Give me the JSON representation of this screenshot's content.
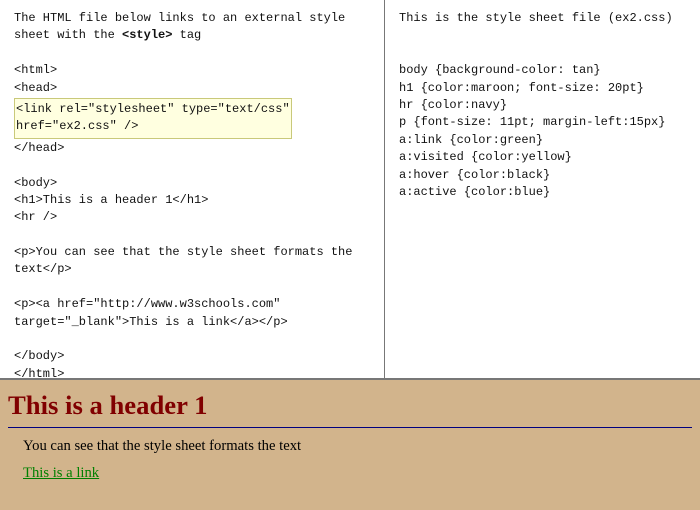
{
  "left": {
    "intro_pre": "The HTML file below links to an external style sheet with the ",
    "intro_bold": "<style>",
    "intro_post": " tag",
    "code1": "<html>",
    "code2": "<head>",
    "hl1": "<link rel=\"stylesheet\" type=\"text/css\"",
    "hl2": " href=\"ex2.css\" />",
    "code3": "</head>",
    "code4": "<body>",
    "code5": "<h1>This is a header 1</h1>",
    "code6": "<hr />",
    "code7": "<p>You can see that the style sheet formats the text</p>",
    "code8": "<p><a href=\"http://www.w3schools.com\" target=\"_blank\">This is a link</a></p>",
    "code9": "</body>",
    "code10": "</html>"
  },
  "right": {
    "intro": "This is the style sheet file (ex2.css)",
    "l1": "body {background-color: tan}",
    "l2": "h1 {color:maroon; font-size: 20pt}",
    "l3": "hr {color:navy}",
    "l4": "p {font-size: 11pt; margin-left:15px}",
    "l5": "a:link    {color:green}",
    "l6": "a:visited {color:yellow}",
    "l7": "a:hover   {color:black}",
    "l8": "a:active  {color:blue}"
  },
  "preview": {
    "heading": "This is a header 1",
    "paragraph": "You can see that the style sheet formats the text",
    "link_text": "This is a link"
  }
}
